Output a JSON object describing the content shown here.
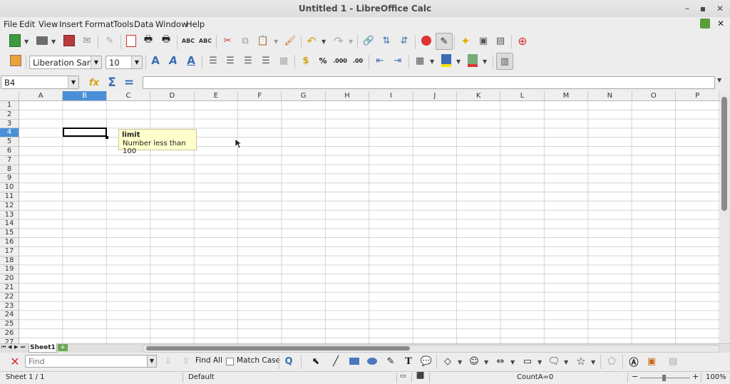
{
  "window": {
    "title": "Untitled 1 - LibreOffice Calc"
  },
  "menu": [
    "File",
    "Edit",
    "View",
    "Insert",
    "Format",
    "Tools",
    "Data",
    "Window",
    "Help"
  ],
  "formatting": {
    "font_name": "Liberation Sans",
    "font_size": "10"
  },
  "formula_bar": {
    "name_box": "B4",
    "input": ""
  },
  "columns": [
    "A",
    "B",
    "C",
    "D",
    "E",
    "F",
    "G",
    "H",
    "I",
    "J",
    "K",
    "L",
    "M",
    "N",
    "O",
    "P"
  ],
  "rows": [
    "1",
    "2",
    "3",
    "4",
    "5",
    "6",
    "7",
    "8",
    "9",
    "10",
    "11",
    "12",
    "13",
    "14",
    "15",
    "16",
    "17",
    "18",
    "19",
    "20",
    "21",
    "22",
    "23",
    "24",
    "25",
    "26",
    "27"
  ],
  "selection": {
    "cell": "B4",
    "column": "B",
    "row": "4"
  },
  "tooltip": {
    "title": "limit",
    "text": "Number less than 100"
  },
  "sheet_tabs": [
    {
      "label": "Sheet1",
      "active": true
    }
  ],
  "find_bar": {
    "placeholder": "Find",
    "find_all": "Find All",
    "match_case": "Match Case"
  },
  "status": {
    "sheet": "Sheet 1 / 1",
    "style": "Default",
    "count": "CountA=0",
    "zoom": "100%"
  },
  "colors": {
    "selection": "#4a90d9",
    "tooltip_bg": "#ffffcc",
    "close_red": "#d9302c"
  }
}
